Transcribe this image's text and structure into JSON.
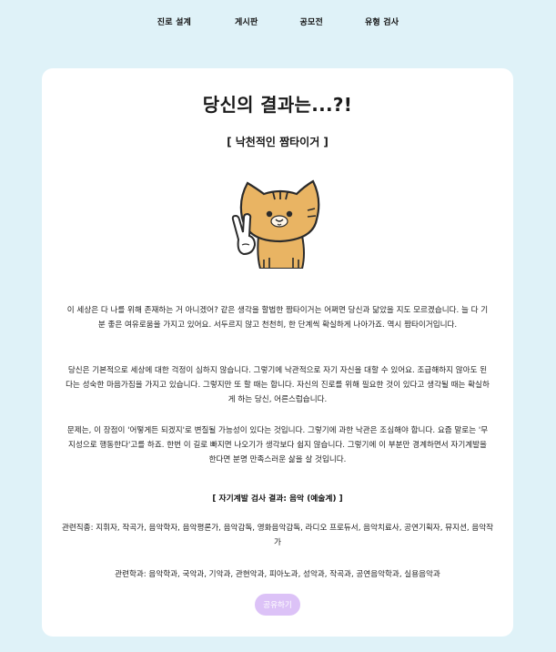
{
  "nav": {
    "items": [
      "진로 설계",
      "게시판",
      "공모전",
      "유형 검사"
    ]
  },
  "result": {
    "title": "당신의 결과는...?!",
    "type_name": "[ 낙천적인 짬타이거 ]",
    "paragraphs": [
      "이 세상은 다 나를 위해 존재하는 거 아니겠어? 같은 생각을 할법한 짬타이거는 어쩌면 당신과 닮았을 지도 모르겠습니다. 늘 다 기분 좋은 여유로움을 가지고 있어요. 서두르지 않고 천천히, 한 단계씩 확실하게 나아가죠. 역시 짬타이거입니다.",
      "당신은 기본적으로 세상에 대한 걱정이 심하지 않습니다. 그렇기에 낙관적으로 자기 자신을 대할 수 있어요. 조급해하지 않아도 된다는 성숙한 마음가짐을 가지고 있습니다. 그렇지만 또 할 때는 합니다. 자신의 진로를 위해 필요한 것이 있다고 생각될 때는 확실하게 하는 당신, 어른스럽습니다.",
      "문제는, 이 장점이 '어떻게든 되겠지'로 변질될 가능성이 있다는 것입니다. 그렇기에 과한 낙관은 조심해야 합니다. 요즘 말로는 '무지성으로 행동한다'고를 하죠. 한번 이 길로 빠지면 나오기가 생각보다 쉽지 않습니다. 그렇기에 이 부분만 경계하면서 자기계발을 한다면 분명 만족스러운 삶을 살 것입니다."
    ],
    "dev_result": "[ 자기계발 검사 결과: 음악 (예술계) ]",
    "jobs": "관련직종: 지휘자, 작곡가, 음악학자, 음악평론가, 음악감독, 영화음악감독, 라디오 프로듀서, 음악치료사, 공연기획자, 뮤지션, 음악작가",
    "majors": "관련학과: 음악학과, 국악과, 기악과, 관현악과, 피아노과, 성악과, 작곡과, 공연음악학과, 실용음악과",
    "share_label": "공유하기"
  },
  "colors": {
    "page_bg": "#dff2f8",
    "card_bg": "#ffffff",
    "share_button": "#dcc2f7",
    "cat_fur": "#e9b463"
  },
  "icons": {
    "illustration": "cat-character-v-sign"
  }
}
